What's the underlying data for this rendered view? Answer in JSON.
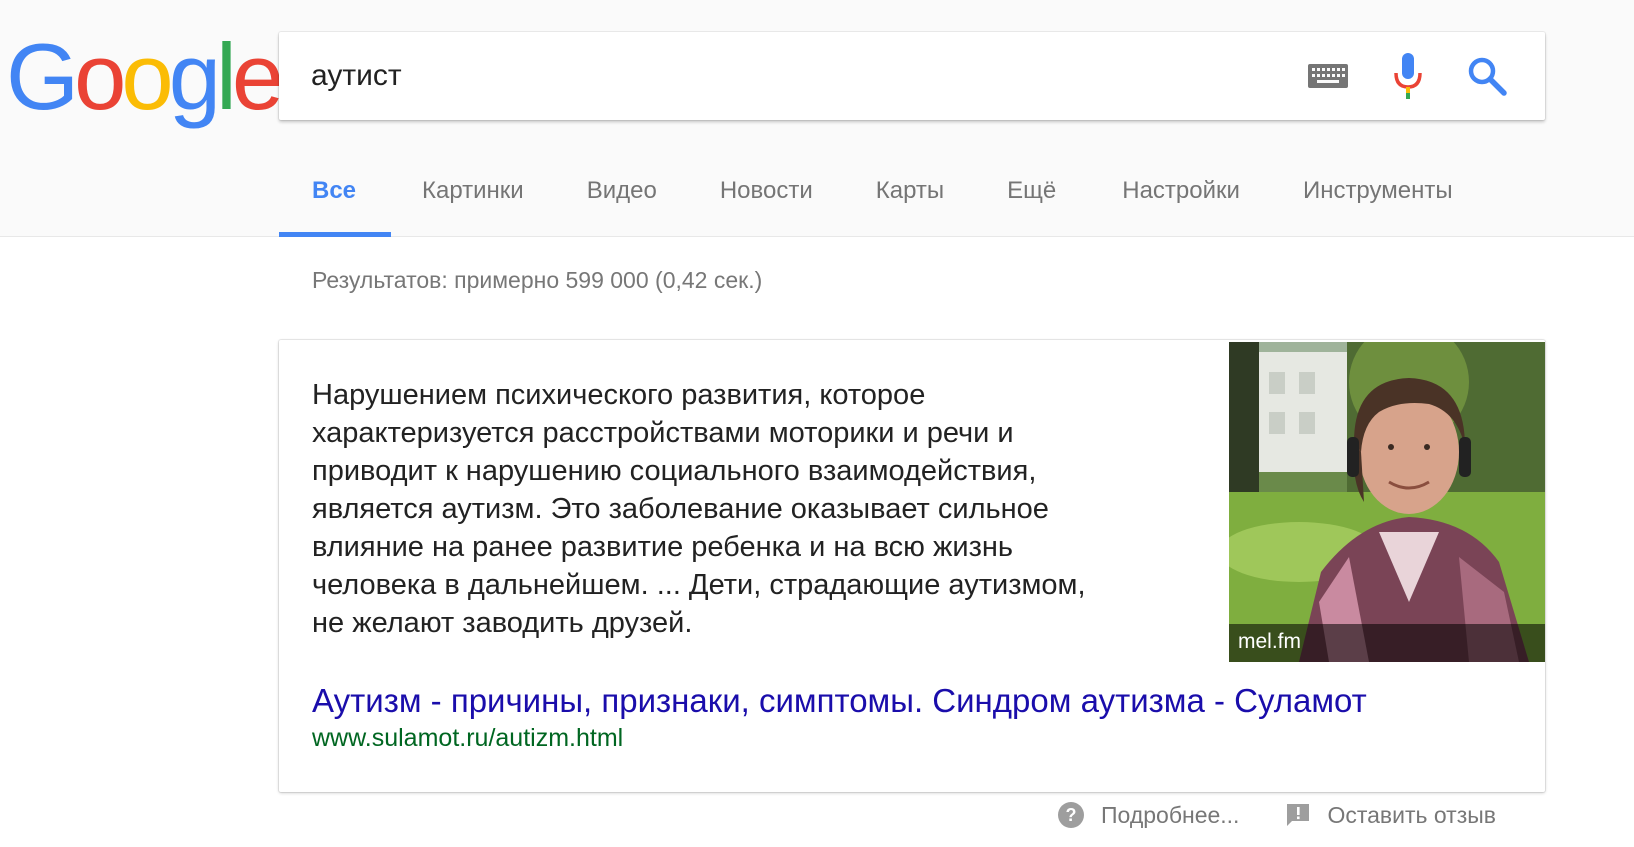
{
  "logo": {
    "letters": [
      "G",
      "o",
      "o",
      "g",
      "l",
      "e"
    ],
    "colors": [
      "#4285f4",
      "#ea4335",
      "#fbbc05",
      "#4285f4",
      "#34a853",
      "#ea4335"
    ]
  },
  "search": {
    "query": "аутист",
    "keyboard_icon": "keyboard-icon",
    "mic_icon": "mic-icon",
    "search_icon": "search-icon"
  },
  "tabs": [
    {
      "label": "Все",
      "active": true
    },
    {
      "label": "Картинки",
      "active": false
    },
    {
      "label": "Видео",
      "active": false
    },
    {
      "label": "Новости",
      "active": false
    },
    {
      "label": "Карты",
      "active": false
    },
    {
      "label": "Ещё",
      "active": false
    },
    {
      "label": "Настройки",
      "active": false
    },
    {
      "label": "Инструменты",
      "active": false
    }
  ],
  "result_stats": "Результатов: примерно 599 000 (0,42 сек.)",
  "featured_snippet": {
    "text_lines": [
      "Нарушением психического развития, которое",
      "характеризуется расстройствами моторики и речи и",
      "приводит к нарушению социального взаимодействия,",
      "является аутизм. Это заболевание оказывает сильное",
      "влияние на ранее развитие ребенка и на всю жизнь",
      "человека в дальнейшем. ... Дети, страдающие аутизмом,",
      "не желают заводить друзей."
    ],
    "image_caption": "mel.fm",
    "title": "Аутизм - причины, признаки, симптомы. Синдром аутизма - Суламот",
    "url": "www.sulamot.ru/autizm.html"
  },
  "footer": {
    "more_label": "Подробнее...",
    "more_icon": "help-circle-icon",
    "feedback_label": "Оставить отзыв",
    "feedback_icon": "feedback-icon"
  },
  "colors": {
    "accent": "#4285f4",
    "link": "#1a0dab",
    "url": "#006621",
    "muted": "#777777"
  }
}
